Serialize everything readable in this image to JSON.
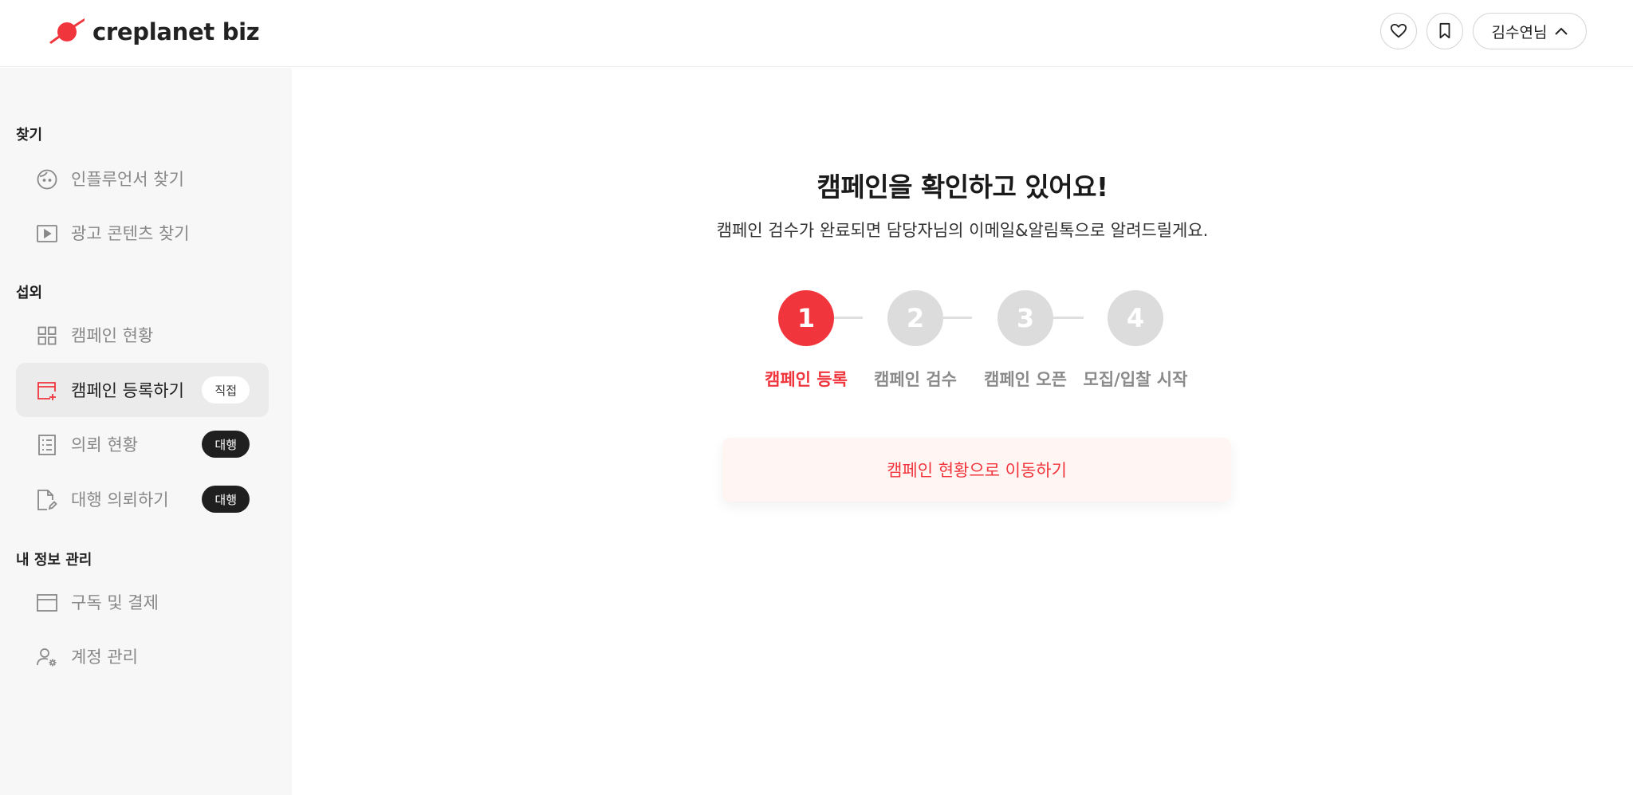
{
  "header": {
    "logo_text": "creplanet biz",
    "user_name": "김수연님",
    "brand_color": "#f0353d"
  },
  "sidebar": {
    "sections": [
      {
        "title": "찾기"
      },
      {
        "title": "섭외"
      },
      {
        "title": "내 정보 관리"
      }
    ],
    "items": [
      {
        "label": "인플루언서 찾기",
        "icon": "face-icon"
      },
      {
        "label": "광고 콘텐츠 찾기",
        "icon": "play-icon"
      },
      {
        "label": "캠페인 현황",
        "icon": "grid-icon"
      },
      {
        "label": "캠페인 등록하기",
        "icon": "calendar-plus-icon",
        "badge": "직접",
        "active": true
      },
      {
        "label": "의뢰 현황",
        "icon": "list-icon",
        "badge": "대행"
      },
      {
        "label": "대행 의뢰하기",
        "icon": "document-edit-icon",
        "badge": "대행"
      },
      {
        "label": "구독 및 결제",
        "icon": "card-icon"
      },
      {
        "label": "계정 관리",
        "icon": "user-settings-icon"
      }
    ]
  },
  "main": {
    "title": "캠페인을 확인하고 있어요!",
    "subtitle": "캠페인 검수가 완료되면 담당자님의 이메일&알림톡으로 알려드릴게요.",
    "steps": [
      {
        "number": "1",
        "label": "캠페인 등록",
        "active": true
      },
      {
        "number": "2",
        "label": "캠페인 검수"
      },
      {
        "number": "3",
        "label": "캠페인 오픈"
      },
      {
        "number": "4",
        "label": "모집/입찰 시작"
      }
    ],
    "action_button": "캠페인 현황으로 이동하기"
  }
}
